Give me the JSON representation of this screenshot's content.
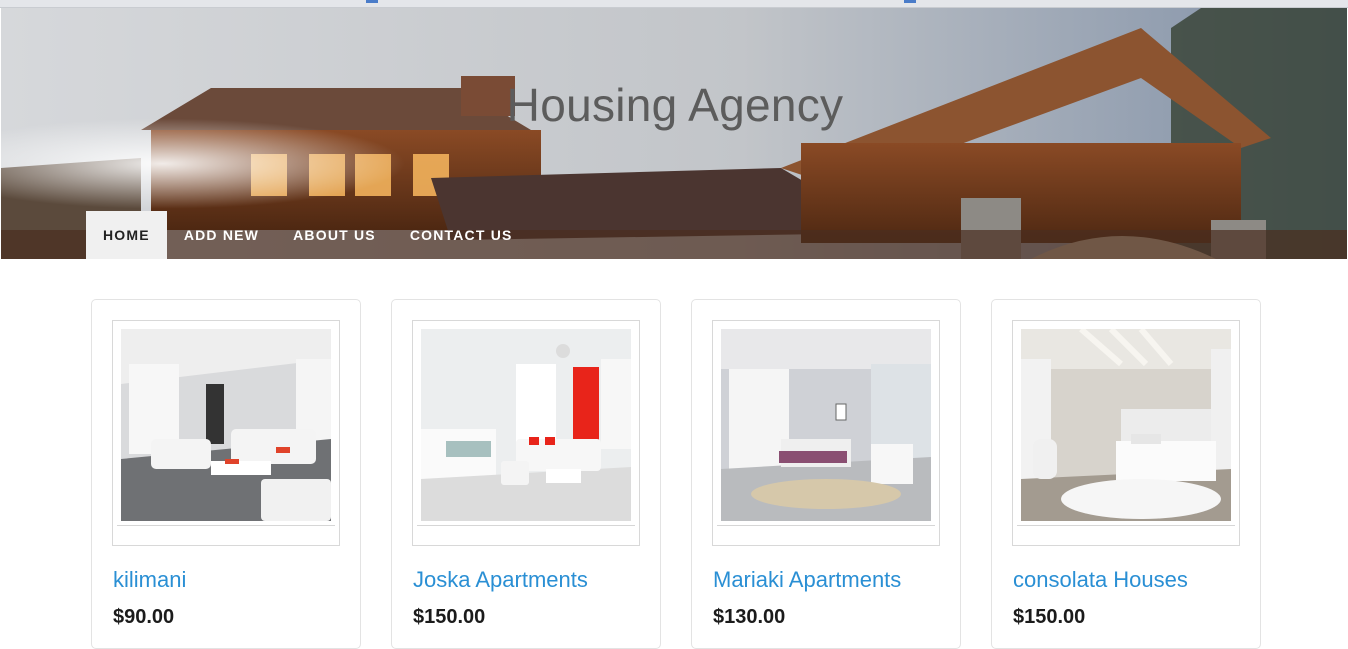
{
  "site": {
    "title": "Housing Agency"
  },
  "nav": {
    "items": [
      {
        "label": "HOME",
        "active": true
      },
      {
        "label": "ADD NEW",
        "active": false
      },
      {
        "label": "ABOUT US",
        "active": false
      },
      {
        "label": "CONTACT US",
        "active": false
      }
    ]
  },
  "listings": [
    {
      "title": "kilimani",
      "price": "$90.00",
      "image": "living-room-white-sofas"
    },
    {
      "title": "Joska Apartments",
      "price": "$150.00",
      "image": "living-room-red-curtain"
    },
    {
      "title": "Mariaki Apartments",
      "price": "$130.00",
      "image": "bedroom-purple-bed"
    },
    {
      "title": "consolata Houses",
      "price": "$150.00",
      "image": "bedroom-white-rug"
    }
  ],
  "colors": {
    "link": "#2a8fd4",
    "nav_active_bg": "#f0f0f0",
    "title": "#5c5c5c"
  }
}
